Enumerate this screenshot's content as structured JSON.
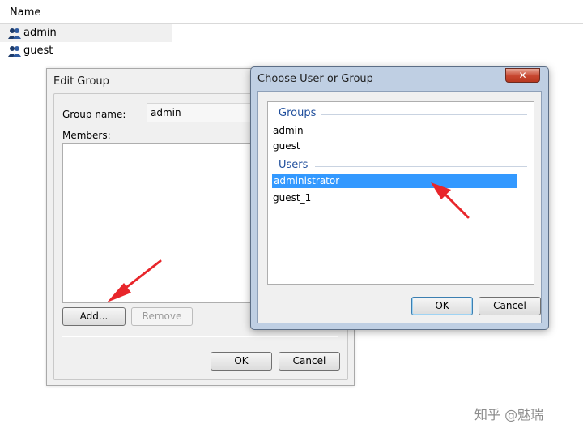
{
  "list": {
    "header": "Name",
    "rows": [
      {
        "label": "admin",
        "selected": true
      },
      {
        "label": "guest",
        "selected": false
      }
    ]
  },
  "edit_group": {
    "title": "Edit Group",
    "group_name_label": "Group name:",
    "group_name_value": "admin",
    "members_label": "Members:",
    "add_button": "Add...",
    "remove_button": "Remove",
    "ok_button": "OK",
    "cancel_button": "Cancel"
  },
  "choose_dialog": {
    "title": "Choose User or Group",
    "close_icon": "close-icon",
    "groups_header": "Groups",
    "groups": [
      "admin",
      "guest"
    ],
    "users_header": "Users",
    "users": [
      "administrator",
      "guest_1"
    ],
    "selected_user": "administrator",
    "ok_button": "OK",
    "cancel_button": "Cancel"
  },
  "watermark": "知乎 @魅瑞",
  "colors": {
    "selection": "#3399ff",
    "group_header": "#1f4e9c",
    "arrow": "#e8262b",
    "close_button": "#c7462f"
  }
}
